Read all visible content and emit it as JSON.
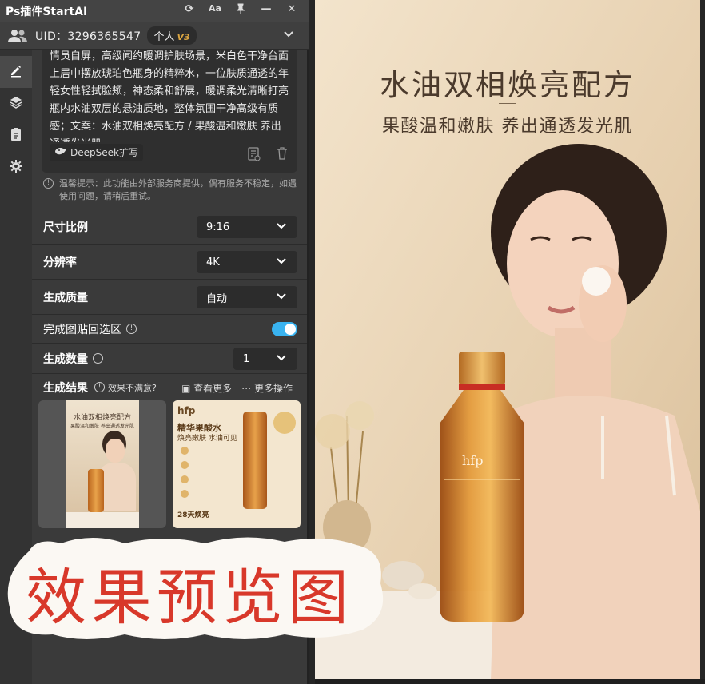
{
  "window": {
    "title": "Ps插件StartAI",
    "icons": [
      "refresh-icon",
      "font-size-icon",
      "pin-icon",
      "minimize-icon",
      "close-icon"
    ]
  },
  "user": {
    "uid": "UID：3296365547",
    "plan": "个人",
    "plan_level": "V3"
  },
  "sidebar": {
    "items": [
      "pencil-icon",
      "layers-icon",
      "clipboard-icon",
      "gear-icon"
    ]
  },
  "prompt": {
    "text": "情员自屏，高级闻约暖调护肤场景，米白色干净台面上居中摆放琥珀色瓶身的精粹水，一位肤质通透的年轻女性轻拭脸颊，神态柔和舒展，暖调柔光清晰打亮瓶内水油双层的悬油质地，整体氛围干净高级有质感；文案：水油双相焕亮配方 / 果酸温和嫩肤 养出通透发光肌",
    "expand_label": "DeepSeek扩写"
  },
  "notice": "温馨提示：此功能由外部服务商提供，偶有服务不稳定，如遇使用问题，请稍后重试。",
  "settings": {
    "ratio_label": "尺寸比例",
    "ratio_value": "9:16",
    "resolution_label": "分辨率",
    "resolution_value": "4K",
    "quality_label": "生成质量",
    "quality_value": "自动",
    "paste_back_label": "完成图贴回选区",
    "paste_back_on": true,
    "count_label": "生成数量",
    "count_value": "1"
  },
  "results": {
    "label": "生成结果",
    "hint": "效果不满意?",
    "more_label": "查看更多",
    "ops_label": "更多操作",
    "thumbs": [
      {
        "title": "水油双相焕亮配方",
        "sub": "果酸温和嫩肤 养出通透发光肌"
      },
      {
        "brand": "hfp",
        "title": "精华果酸水",
        "sub": "焕亮嫩肤 水油可见",
        "badge": "28天焕亮"
      }
    ]
  },
  "preview": {
    "title": "水油双相焕亮配方",
    "subtitle": "果酸温和嫩肤 养出通透发光肌",
    "bottle_brand": "hfp"
  },
  "overlay": {
    "text": "效果预览图"
  },
  "colors": {
    "accent": "#39b3f0",
    "panel_bg": "#3a3a3a",
    "overlay_text": "#d8382a",
    "preview_bg": "#e9d6ba"
  }
}
